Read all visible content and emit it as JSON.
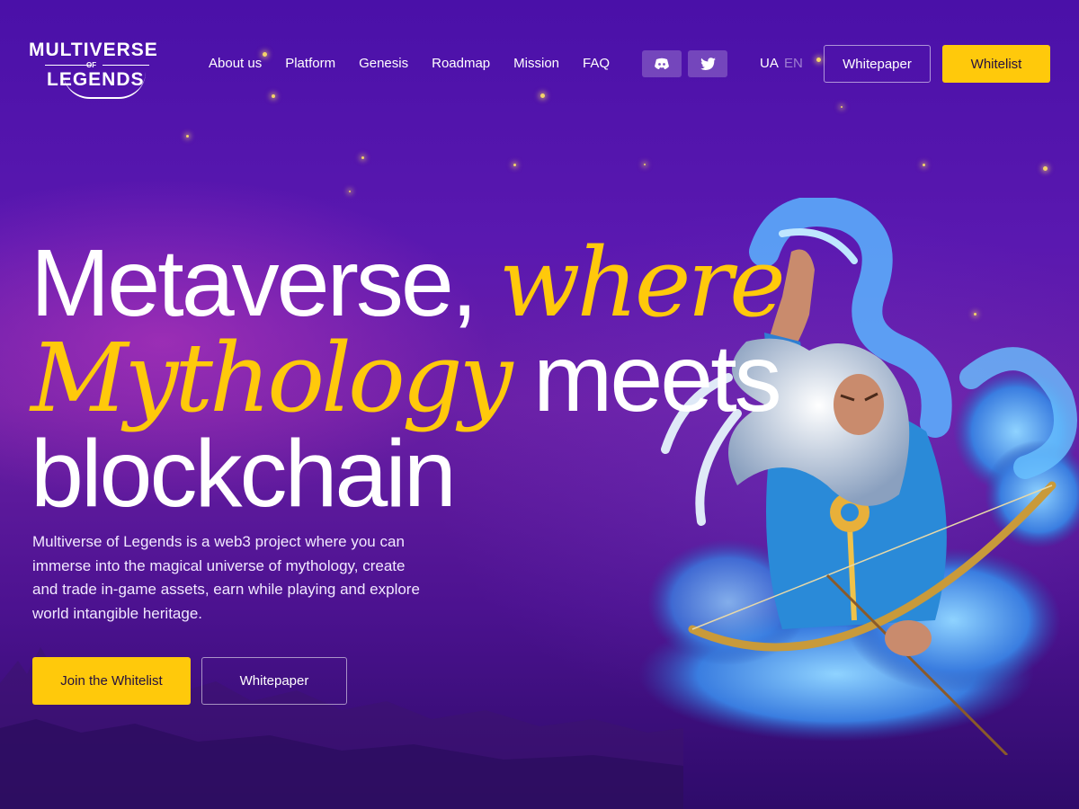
{
  "header": {
    "logo": {
      "line1": "MULTIVERSE",
      "line2": "OF",
      "line3": "LEGENDS"
    },
    "nav": [
      "About us",
      "Platform",
      "Genesis",
      "Roadmap",
      "Mission",
      "FAQ"
    ],
    "social": [
      {
        "icon": "discord-icon"
      },
      {
        "icon": "twitter-icon"
      }
    ],
    "languages": {
      "active": "UA",
      "inactive": "EN"
    },
    "whitepaper_label": "Whitepaper",
    "whitelist_label": "Whitelist"
  },
  "hero": {
    "headline": {
      "part1": "Metaverse,",
      "part2_accent": "where",
      "part3_accent": "Mythology",
      "part4": "meets",
      "part5": "blockchain"
    },
    "description": "Multiverse of Legends is a web3 project where you can immerse into the magical universe of mythology, create and trade in-game assets, earn while playing and explore world intangible heritage.",
    "primary_cta": "Join the Whitelist",
    "secondary_cta": "Whitepaper"
  },
  "colors": {
    "accent": "#ffc90b",
    "background": "#4a10a8",
    "text": "#ffffff"
  }
}
